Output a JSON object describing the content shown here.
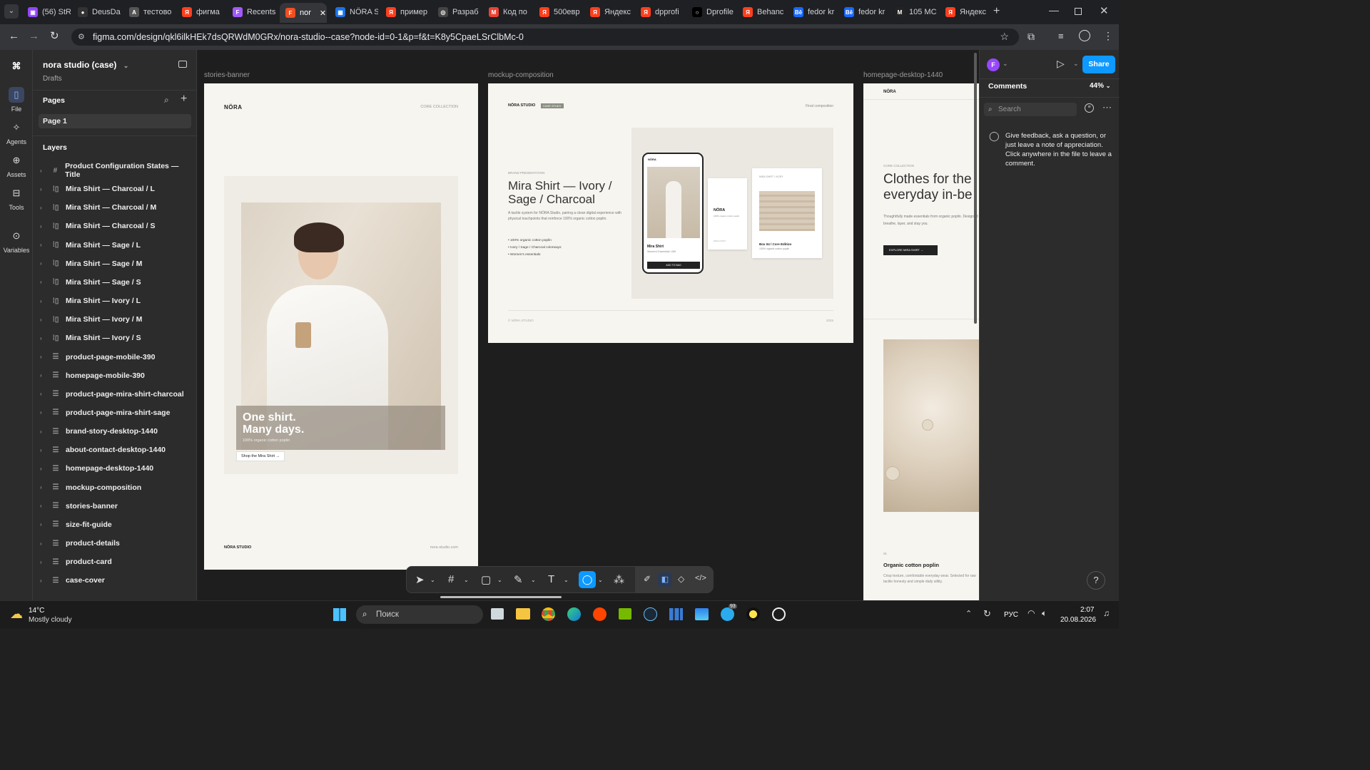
{
  "browser": {
    "tabs": [
      {
        "label": "(56) StR",
        "icon": "twitch-icon",
        "color": "#9146ff"
      },
      {
        "label": "DeusDa",
        "icon": "github-icon",
        "color": "#333"
      },
      {
        "label": "тестово",
        "icon": "person-icon",
        "color": "#555"
      },
      {
        "label": "фигма",
        "icon": "yandex-icon",
        "color": "#fc3f1d"
      },
      {
        "label": "Recents",
        "icon": "figma-icon",
        "color": "#a259ff"
      },
      {
        "label": "nor",
        "icon": "figma-icon",
        "color": "#f24e1e"
      },
      {
        "label": "NÖRA S",
        "icon": "grid-icon",
        "color": "#1a73e8"
      },
      {
        "label": "пример",
        "icon": "yandex-icon",
        "color": "#fc3f1d"
      },
      {
        "label": "Разраб",
        "icon": "openai-icon",
        "color": "#444"
      },
      {
        "label": "Код по",
        "icon": "gmail-icon",
        "color": "#ea4335"
      },
      {
        "label": "500евр",
        "icon": "yandex-icon",
        "color": "#fc3f1d"
      },
      {
        "label": "Яндекс",
        "icon": "yandex-icon",
        "color": "#fc3f1d"
      },
      {
        "label": "dpprofi",
        "icon": "yandex-icon",
        "color": "#fc3f1d"
      },
      {
        "label": "Dprofile",
        "icon": "circle-icon",
        "color": "#000"
      },
      {
        "label": "Behanc",
        "icon": "yandex-icon",
        "color": "#fc3f1d"
      },
      {
        "label": "fedor kr",
        "icon": "behance-icon",
        "color": "#1769ff"
      },
      {
        "label": "fedor kr",
        "icon": "behance-icon",
        "color": "#1769ff"
      },
      {
        "label": "105 MC",
        "icon": "m-icon",
        "color": "#222"
      },
      {
        "label": "Яндекс",
        "icon": "yandex-icon",
        "color": "#fc3f1d"
      }
    ],
    "url": "figma.com/design/qkl6ilkHEk7dsQRWdM0GRx/nora-studio--case?node-id=0-1&p=f&t=K8y5CpaeLSrClbMc-0"
  },
  "rail": {
    "items": [
      {
        "label": "File"
      },
      {
        "label": "Agents"
      },
      {
        "label": "Assets"
      },
      {
        "label": "Tools"
      },
      {
        "label": "Variables"
      }
    ]
  },
  "file": {
    "name": "nora studio (case)",
    "location": "Drafts"
  },
  "pages": {
    "title": "Pages",
    "current": "Page 1"
  },
  "layers": {
    "title": "Layers",
    "items": [
      {
        "label": "Product Configuration States — Title",
        "icon": "frame-grid-icon"
      },
      {
        "label": "Mira Shirt — Charcoal / L",
        "icon": "component-set-icon"
      },
      {
        "label": "Mira Shirt — Charcoal / M",
        "icon": "component-set-icon"
      },
      {
        "label": "Mira Shirt — Charcoal / S",
        "icon": "component-set-icon"
      },
      {
        "label": "Mira Shirt — Sage / L",
        "icon": "component-set-icon"
      },
      {
        "label": "Mira Shirt — Sage / M",
        "icon": "component-set-icon"
      },
      {
        "label": "Mira Shirt — Sage / S",
        "icon": "component-set-icon"
      },
      {
        "label": "Mira Shirt — Ivory / L",
        "icon": "component-set-icon"
      },
      {
        "label": "Mira Shirt — Ivory / M",
        "icon": "component-set-icon"
      },
      {
        "label": "Mira Shirt — Ivory / S",
        "icon": "component-set-icon"
      },
      {
        "label": "product-page-mobile-390",
        "icon": "frame-rows-icon"
      },
      {
        "label": "homepage-mobile-390",
        "icon": "frame-rows-icon"
      },
      {
        "label": "product-page-mira-shirt-charcoal",
        "icon": "frame-rows-icon"
      },
      {
        "label": "product-page-mira-shirt-sage",
        "icon": "frame-rows-icon"
      },
      {
        "label": "brand-story-desktop-1440",
        "icon": "frame-rows-icon"
      },
      {
        "label": "about-contact-desktop-1440",
        "icon": "frame-rows-icon"
      },
      {
        "label": "homepage-desktop-1440",
        "icon": "frame-rows-icon"
      },
      {
        "label": "mockup-composition",
        "icon": "frame-rows-icon"
      },
      {
        "label": "stories-banner",
        "icon": "frame-rows-icon"
      },
      {
        "label": "size-fit-guide",
        "icon": "frame-rows-icon"
      },
      {
        "label": "product-details",
        "icon": "frame-rows-icon"
      },
      {
        "label": "product-card",
        "icon": "frame-rows-icon"
      },
      {
        "label": "case-cover",
        "icon": "frame-rows-icon"
      }
    ]
  },
  "frames": {
    "stories": {
      "label": "stories-banner",
      "brand": "NÖRA",
      "collection": "CORE COLLECTION",
      "headline_1": "One shirt.",
      "headline_2": "Many days.",
      "sub": "100% organic cotton poplin",
      "cta": "Shop the Mira Shirt →",
      "footer_left": "NÖRA STUDIO",
      "footer_right": "nora-studio.com"
    },
    "mockup": {
      "label": "mockup-composition",
      "brand": "NÖRA STUDIO",
      "badge": "CASE STUDY",
      "right": "Final composition",
      "eyebrow": "BRAND PRESENTATION",
      "title_1": "Mira Shirt — Ivory /",
      "title_2": "Sage / Charcoal",
      "body": "A tactile system for NÖRA Studio, pairing a clean digital experience with physical touchpoints that reinforce 100% organic cotton poplin.",
      "bullets": [
        "100% organic cotton poplin",
        "Ivory / Sage / Charcoal colorways",
        "Women's essentials"
      ],
      "phone_brand": "NÖRA",
      "phone_name": "Mira Shirt",
      "phone_meta": "Women's Essentials / £89",
      "phone_cta": "ADD TO BAG",
      "tag_brand": "NÖRA",
      "tag_sub": "100% organic cotton poplin",
      "tag_foot": "MIRA IVORY",
      "box_title": "MIRA SHIRT / IVORY",
      "box_name": "Box 04 / Core Edition",
      "box_sub": "100% organic cotton poplin",
      "footer_left": "© NÖRA STUDIO",
      "footer_right": "2025"
    },
    "homepage": {
      "label": "homepage-desktop-1440",
      "brand": "NÖRA",
      "eyebrow": "CORE COLLECTION",
      "title_1": "Clothes for the",
      "title_2": "everyday in-be",
      "body": "Thoughtfully made essentials from organic poplin. Designed to breathe, layer, and stay you.",
      "cta": "EXPLORE MIRA SHIRT",
      "num": "01",
      "feat_title": "Organic cotton poplin",
      "feat_body": "Crisp texture, comfortable everyday wear. Selected for raw tactile honesty and simple daily utility."
    }
  },
  "toolbar": {
    "tools": [
      "move-tool",
      "frame-tool",
      "shape-tool",
      "pen-tool",
      "text-tool",
      "comment-tool",
      "actions-tool"
    ],
    "modes": [
      "draw-mode",
      "design-mode",
      "prototype-mode",
      "dev-mode"
    ]
  },
  "right": {
    "avatar": "F",
    "share": "Share",
    "tab": "Comments",
    "zoom": "44%",
    "search_placeholder": "Search",
    "hint": "Give feedback, ask a question, or just leave a note of appreciation. Click anywhere in the file to leave a comment.",
    "help": "?"
  },
  "taskbar": {
    "weather_temp": "14°C",
    "weather_desc": "Mostly cloudy",
    "search": "Поиск",
    "lang": "РУС",
    "time": "2:07",
    "date": "20.08.2026",
    "badge": "93"
  },
  "colors": {
    "accent": "#0d99ff",
    "avatar": "#9747ff",
    "canvas": "#1e1e1e",
    "panel": "#2c2c2c"
  }
}
